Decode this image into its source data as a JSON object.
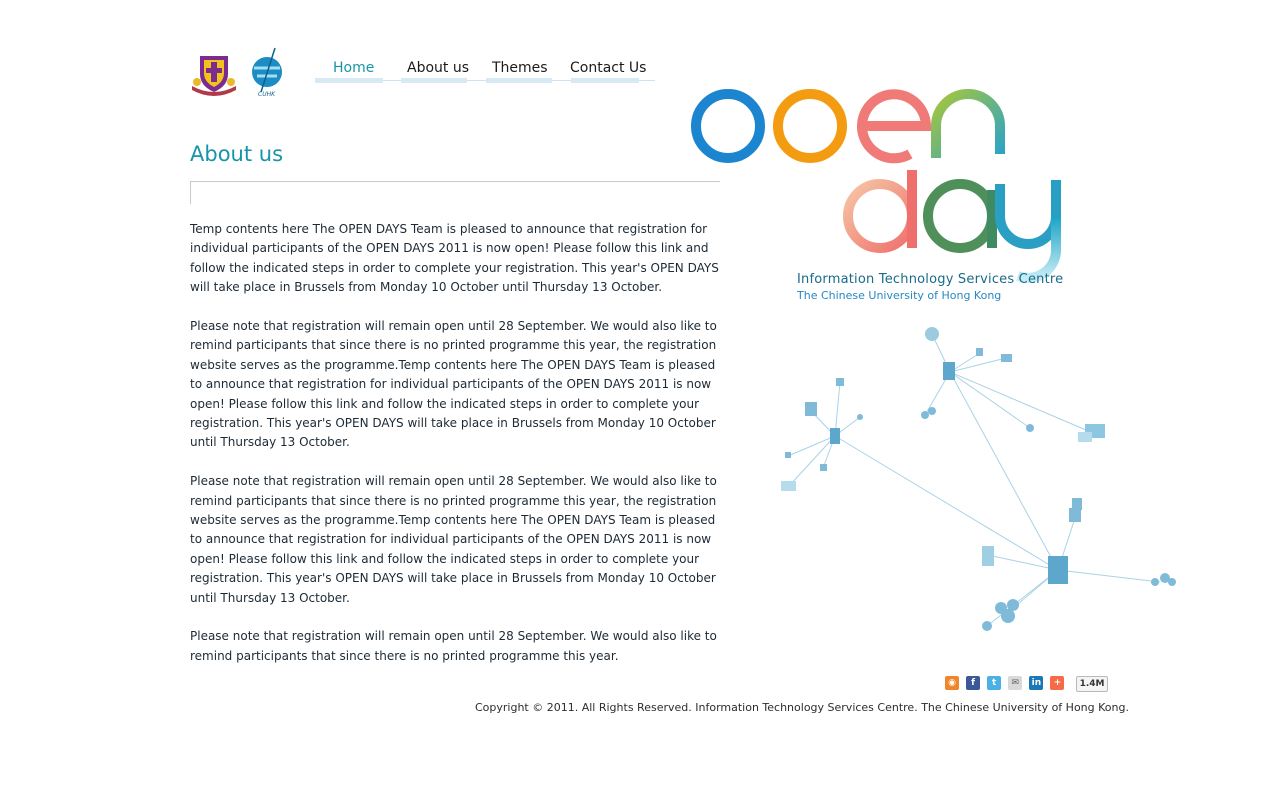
{
  "nav": {
    "items": [
      {
        "label": "Home",
        "active": true
      },
      {
        "label": "About us",
        "active": false
      },
      {
        "label": "Themes",
        "active": false
      },
      {
        "label": "Contact Us",
        "active": false
      }
    ]
  },
  "page": {
    "title": "About us",
    "paragraphs": [
      "Temp contents here The OPEN DAYS Team is pleased to announce that registration for individual participants of the OPEN DAYS 2011 is now open! Please follow this link and follow the indicated steps in order to complete your registration. This year's OPEN DAYS will take place in Brussels from Monday 10 October until Thursday 13 October.",
      "Please note that registration will remain open until 28 September. We would also like to remind participants that since there is no printed programme this year, the registration website serves as the programme.Temp contents here The OPEN DAYS Team is pleased to announce that registration for individual participants of the OPEN DAYS 2011 is now open! Please follow this link and follow the indicated steps in order to complete your registration. This year's OPEN DAYS will take place in Brussels from Monday 10 October until Thursday 13 October.",
      "Please note that registration will remain open until 28 September. We would also like to remind participants that since there is no printed programme this year, the registration website serves as the programme.Temp contents here The OPEN DAYS Team is pleased to announce that registration for individual participants of the OPEN DAYS 2011 is now open! Please follow this link and follow the indicated steps in order to complete your registration. This year's OPEN DAYS will take place in Brussels from Monday 10 October until Thursday 13 October.",
      "Please note that registration will remain open until 28 September. We would also like to remind participants that since there is no printed programme this year."
    ]
  },
  "branding": {
    "logo_word_1": "open",
    "logo_word_2": "day",
    "org_name": "Information Technology Services Centre",
    "org_sub": "The Chinese University of Hong Kong",
    "itsc_logo_text": "CUHK"
  },
  "social": {
    "icons": [
      "rss-icon",
      "facebook-icon",
      "twitter-icon",
      "email-icon",
      "linkedin-icon",
      "addthis-icon"
    ],
    "share_count": "1.4M"
  },
  "footer": {
    "copyright": "Copyright © 2011. All Rights Reserved. Information Technology Services Centre. The Chinese University of Hong Kong."
  },
  "colors": {
    "accent": "#1795a8",
    "link_blue": "#2788c4",
    "nav_underline": "#d6e9f4"
  }
}
